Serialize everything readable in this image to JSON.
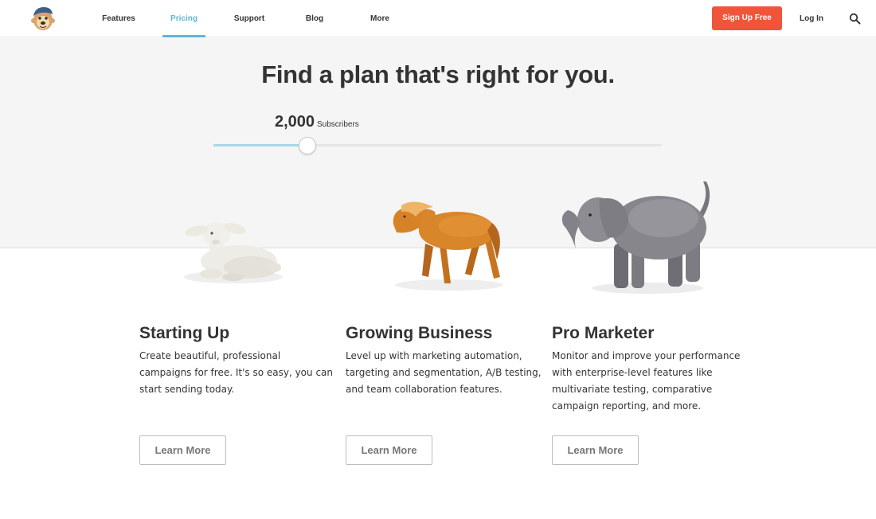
{
  "nav": {
    "items": [
      "Features",
      "Pricing",
      "Support",
      "Blog",
      "More"
    ],
    "active": "Pricing",
    "signup_label": "Sign Up Free",
    "login_label": "Log In",
    "accent_color": "#5cb8d6",
    "signup_color": "#f0553a"
  },
  "hero": {
    "title": "Find a plan that's right for you.",
    "subscriber_count": "2,000",
    "subscriber_label": "Subscribers",
    "slider_value_fraction": 0.21
  },
  "plans": [
    {
      "title": "Starting Up",
      "description_lines": [
        "Create beautiful, professional",
        "campaigns for free. It's so easy, you can",
        "start sending today."
      ],
      "button_label": "Learn More",
      "image": "lamb-figurine"
    },
    {
      "title": "Growing Business",
      "description_lines": [
        "Level up with marketing automation,",
        "targeting and segmentation, A/B testing,",
        "and team collaboration features."
      ],
      "button_label": "Learn More",
      "image": "horse-figurine"
    },
    {
      "title": "Pro Marketer",
      "description_lines": [
        "Monitor and improve your performance",
        "with enterprise-level features like",
        "multivariate testing, comparative",
        "campaign reporting, and more."
      ],
      "button_label": "Learn More",
      "image": "elephant-figurine"
    }
  ]
}
